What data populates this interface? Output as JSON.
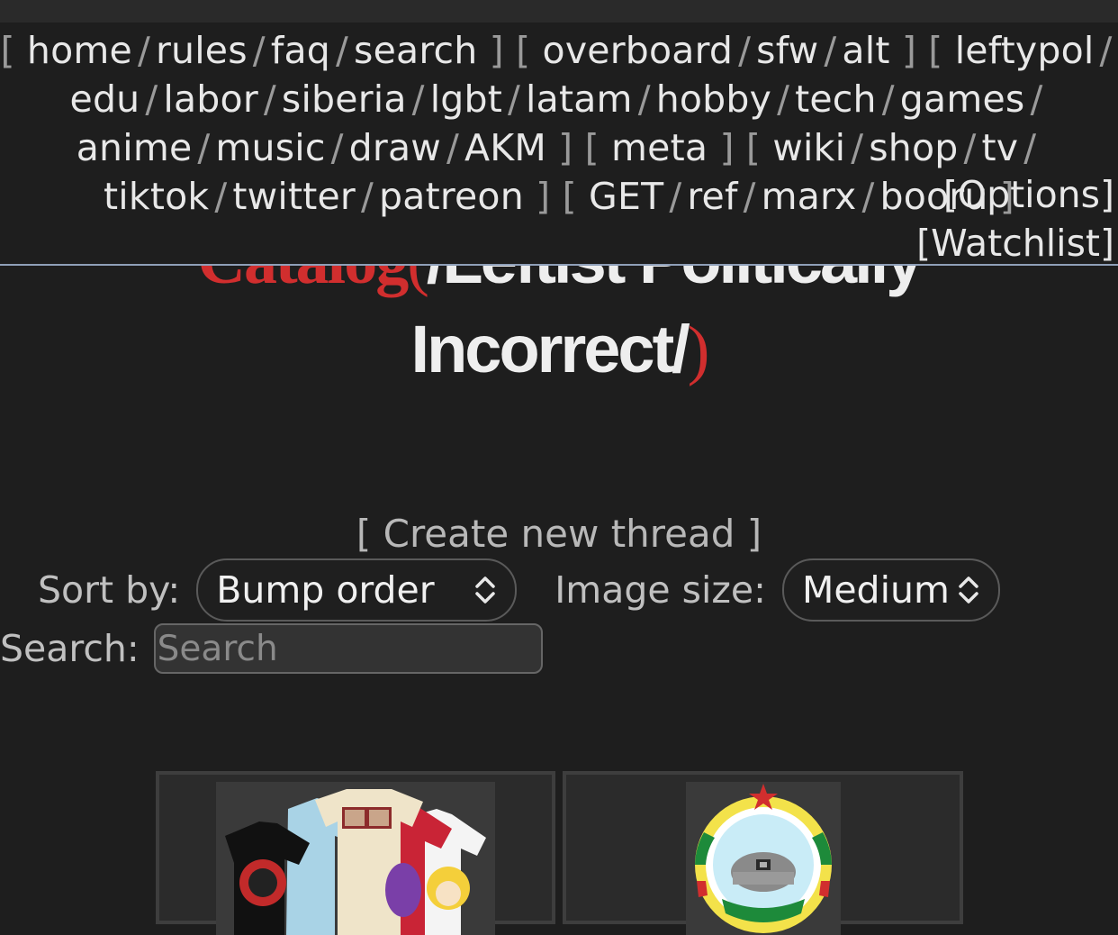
{
  "nav": {
    "groups": [
      [
        "home",
        "rules",
        "faq",
        "search"
      ],
      [
        "overboard",
        "sfw",
        "alt"
      ],
      [
        "leftypol",
        "edu",
        "labor",
        "siberia",
        "lgbt",
        "latam",
        "hobby",
        "tech",
        "games",
        "anime",
        "music",
        "draw",
        "AKM"
      ],
      [
        "meta"
      ],
      [
        "wiki",
        "shop",
        "tv",
        "tiktok",
        "twitter",
        "patreon"
      ],
      [
        "GET",
        "ref",
        "marx",
        "booru"
      ]
    ],
    "options": "[Options]",
    "watchlist": "[Watchlist]"
  },
  "heading": {
    "catalog": "Catalog",
    "open_paren": "(",
    "board_line1": "/Leftist Politically",
    "board_line2": "Incorrect/",
    "close_paren": ")"
  },
  "create_thread": "[ Create new thread ]",
  "controls": {
    "sort_label": "Sort by:",
    "sort_value": "Bump order",
    "size_label": "Image size:",
    "size_value": "Medium",
    "search_label": "Search:",
    "search_placeholder": "Search"
  },
  "threads": [
    {
      "thumb": "t-shirt-merch-photo"
    },
    {
      "thumb": "leftypol-emblem"
    }
  ],
  "colors": {
    "background": "#1e1e1e",
    "accent_red": "#d12e2e",
    "nav_border": "#8f9fb8"
  }
}
